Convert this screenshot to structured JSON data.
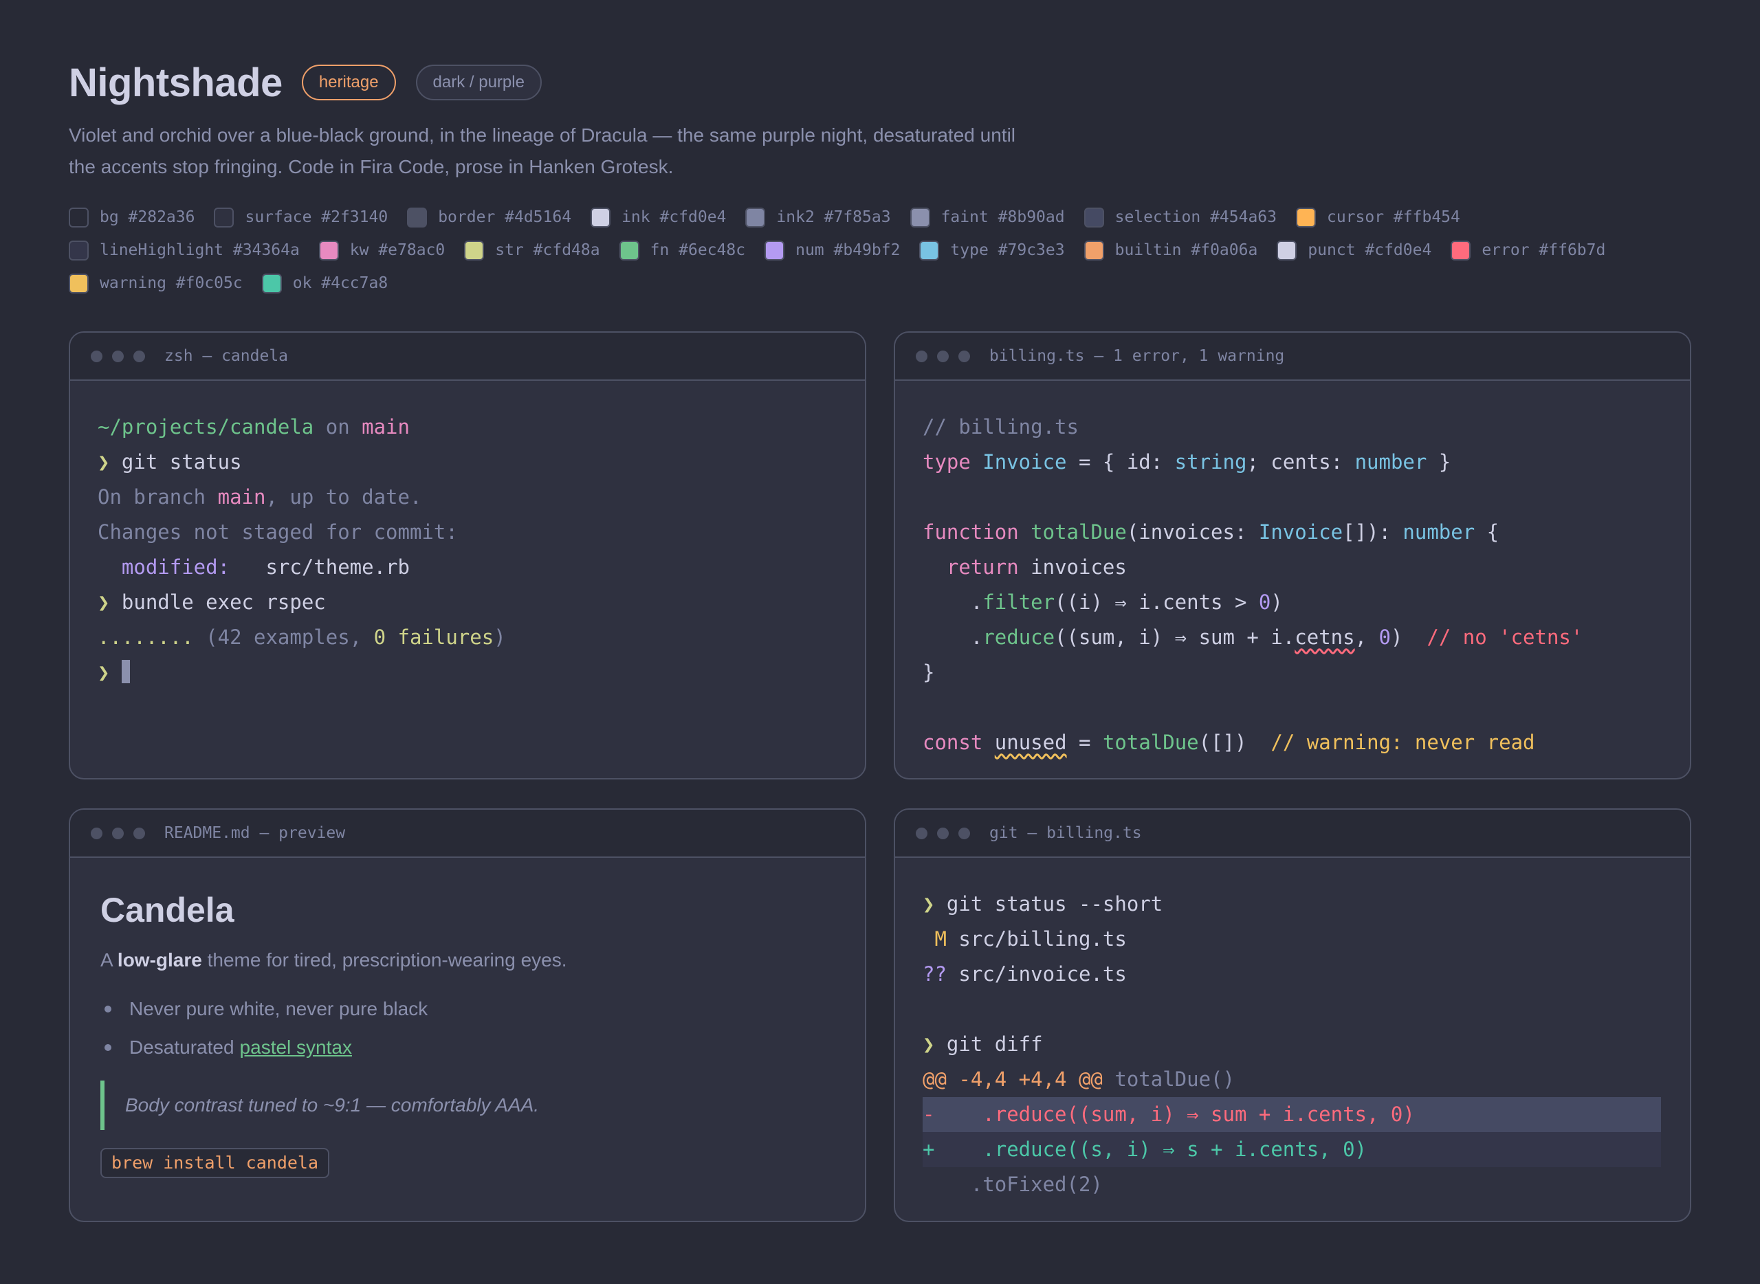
{
  "header": {
    "title": "Nightshade",
    "badge_heritage": "heritage",
    "badge_variant": "dark / purple",
    "description": "Violet and orchid over a blue-black ground, in the lineage of Dracula — the same purple night, desaturated until the accents stop fringing. Code in Fira Code, prose in Hanken Grotesk."
  },
  "palette": [
    {
      "label": "bg #282a36",
      "color": "#282a36"
    },
    {
      "label": "surface #2f3140",
      "color": "#2f3140"
    },
    {
      "label": "border #4d5164",
      "color": "#4d5164"
    },
    {
      "label": "ink #cfd0e4",
      "color": "#cfd0e4"
    },
    {
      "label": "ink2 #7f85a3",
      "color": "#7f85a3"
    },
    {
      "label": "faint #8b90ad",
      "color": "#8b90ad"
    },
    {
      "label": "selection #454a63",
      "color": "#454a63"
    },
    {
      "label": "cursor #ffb454",
      "color": "#ffb454"
    },
    {
      "label": "lineHighlight #34364a",
      "color": "#34364a"
    },
    {
      "label": "kw #e78ac0",
      "color": "#e78ac0"
    },
    {
      "label": "str #cfd48a",
      "color": "#cfd48a"
    },
    {
      "label": "fn #6ec48c",
      "color": "#6ec48c"
    },
    {
      "label": "num #b49bf2",
      "color": "#b49bf2"
    },
    {
      "label": "type #79c3e3",
      "color": "#79c3e3"
    },
    {
      "label": "builtin #f0a06a",
      "color": "#f0a06a"
    },
    {
      "label": "punct #cfd0e4",
      "color": "#cfd0e4"
    },
    {
      "label": "error #ff6b7d",
      "color": "#ff6b7d"
    },
    {
      "label": "warning #f0c05c",
      "color": "#f0c05c"
    },
    {
      "label": "ok #4cc7a8",
      "color": "#4cc7a8"
    }
  ],
  "terminal": {
    "title": "zsh — candela",
    "path": "~/projects/candela",
    "on": " on ",
    "branch": "main",
    "prompt": "❯",
    "cmd1": " git status",
    "out1_a": "On branch ",
    "out1_b": "main",
    "out1_c": ", up to date.",
    "out2": "Changes not staged for commit:",
    "mod_label": "  modified:",
    "mod_file": "   src/theme.rb",
    "cmd2": " bundle exec rspec",
    "dots": "........",
    "res_a": " (42 examples, ",
    "res_b": "0 failures",
    "res_c": ")"
  },
  "editor": {
    "title": "billing.ts — 1 error, 1 warning",
    "comment1": "// billing.ts",
    "kw_type": "type",
    "t_invoice": " Invoice",
    "p1": " = { id: ",
    "t_string": "string",
    "p2": "; cents: ",
    "t_number": "number",
    "p3": " }",
    "kw_function": "function",
    "fn_total": " totalDue",
    "p4": "(invoices: ",
    "t_invoice2": "Invoice",
    "p5": "[]): ",
    "t_number2": "number",
    "p6": " {",
    "kw_return": "  return",
    "id_invoices": " invoices",
    "indent": "    .",
    "fn_filter": "filter",
    "p7": "((i) ⇒ i.cents > ",
    "n0": "0",
    "p8": ")",
    "fn_reduce": "reduce",
    "p9": "((sum, i) ⇒ sum + i.",
    "err_word": "cetns",
    "p10": ", ",
    "n0b": "0",
    "p11": ")  ",
    "err_comment": "// no 'cetns'",
    "close": "}",
    "kw_const": "const",
    "sp": " ",
    "warn_word": "unused",
    "p12": " = ",
    "fn_total2": "totalDue",
    "p13": "([])  ",
    "warn_comment": "// warning: never read"
  },
  "readme": {
    "title": "README.md — preview",
    "h1": "Candela",
    "p_a": "A ",
    "p_b": "low-glare",
    "p_c": " theme for tired, prescription-wearing eyes.",
    "li1": "Never pure white, never pure black",
    "li2_a": "Desaturated",
    "li2_link": "pastel syntax",
    "quote": "Body contrast tuned to ~9:1 — comfortably AAA.",
    "code": "brew install candela"
  },
  "git": {
    "title": "git — billing.ts",
    "prompt": "❯",
    "cmd1": " git status --short",
    "m_flag": " M",
    "m_file": " src/billing.ts",
    "q_flag": "??",
    "q_file": " src/invoice.ts",
    "cmd2": " git diff",
    "hunk": "@@ -4,4 +4,4 @@",
    "hunk_ctx": " totalDue()",
    "del": "-    .reduce((sum, i) ⇒ sum + i.cents, 0)",
    "add": "+    .reduce((s, i) ⇒ s + i.cents, 0)",
    "ctx": "    .toFixed(2)"
  }
}
